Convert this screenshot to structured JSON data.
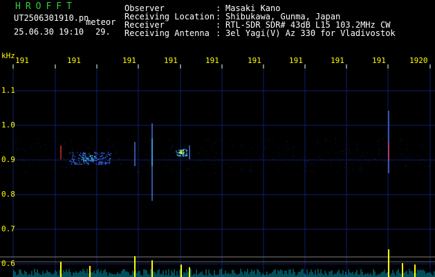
{
  "header": {
    "app_name": "HROFFT",
    "file_name": "UT2506301910.pn",
    "mode_label": "meteor",
    "timestamp": "25.06.30 19:10",
    "count": "29.",
    "fields": [
      {
        "label": "Observer",
        "sep": ":",
        "value": "Masaki Kano"
      },
      {
        "label": "Receiving Location",
        "sep": ":",
        "value": "Shibukawa, Gunma, Japan"
      },
      {
        "label": "Receiver",
        "sep": ":",
        "value": "RTL-SDR SDR# 43dB L15 103.2MHz CW"
      },
      {
        "label": "Receiving Antenna",
        "sep": ":",
        "value": "3el Yagi(V) Az 330 for Vladivostok"
      }
    ]
  },
  "axis": {
    "y_unit": "kHz",
    "y_ticks": [
      "1.1",
      "1.0",
      "0.9",
      "0.8",
      "0.7",
      "0.6"
    ],
    "x_ticks": [
      "191",
      "191",
      "191",
      "191",
      "191",
      "191",
      "191",
      "191",
      "191",
      "1920"
    ]
  },
  "colors": {
    "background": "#000000",
    "header_text": "#ffffff",
    "app_title": "#2fd52f",
    "axis_text": "#ffff00",
    "grid": "#0d1f6b",
    "echo_hot": "#ff3030",
    "echo_warm": "#ffff40",
    "echo_cool": "#40c0ff",
    "amplitude_trace": "#ffff00",
    "amplitude_fill": "#00e0ff"
  }
}
